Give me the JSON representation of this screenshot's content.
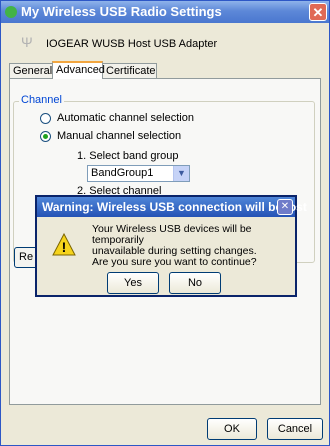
{
  "window": {
    "title": "My Wireless USB Radio Settings",
    "close_glyph": "✕",
    "icon": "wireless-usb-icon"
  },
  "header": {
    "adapter": "IOGEAR WUSB Host USB Adapter",
    "icon": "usb-icon",
    "icon_glyph": "Ψ"
  },
  "tabs": [
    {
      "label": "General"
    },
    {
      "label": "Advanced"
    },
    {
      "label": "Certificate"
    }
  ],
  "channel": {
    "group_title": "Channel",
    "auto_label": "Automatic channel selection",
    "manual_label": "Manual channel selection",
    "selected": "manual",
    "step1": "1. Select band group",
    "band_value": "BandGroup1",
    "step2": "2. Select channel"
  },
  "side_button": {
    "label": "Re"
  },
  "footer": {
    "ok_label": "OK",
    "cancel_label": "Cancel"
  },
  "warning": {
    "title": "Warning: Wireless USB connection will be lost",
    "close_glyph": "✕",
    "line1": "Your Wireless USB devices will be temporarily",
    "line2": "unavailable during setting changes.",
    "line3": "Are you sure you want to continue?",
    "yes_label": "Yes",
    "no_label": "No",
    "icon": "warning-icon",
    "icon_glyph": "!"
  },
  "colors": {
    "title_bar": "#4a77cf",
    "dialog_title": "#2452b5",
    "group_title": "#0046d5",
    "tab_highlight": "#f2a640"
  }
}
